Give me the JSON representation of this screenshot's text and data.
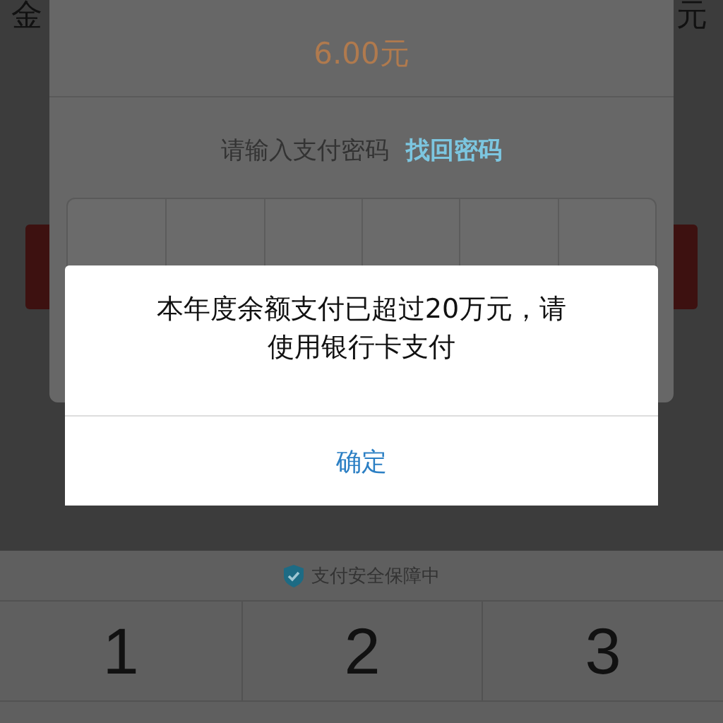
{
  "header": {
    "left": "金",
    "right": "元"
  },
  "payment": {
    "amount": "6.00元",
    "prompt": "请输入支付密码",
    "forgot_link": "找回密码"
  },
  "alert": {
    "message": "本年度余额支付已超过20万元，请使用银行卡支付",
    "button": "确定"
  },
  "keyboard": {
    "security_note": "支付安全保障中",
    "keys": [
      "1",
      "2",
      "3"
    ]
  }
}
